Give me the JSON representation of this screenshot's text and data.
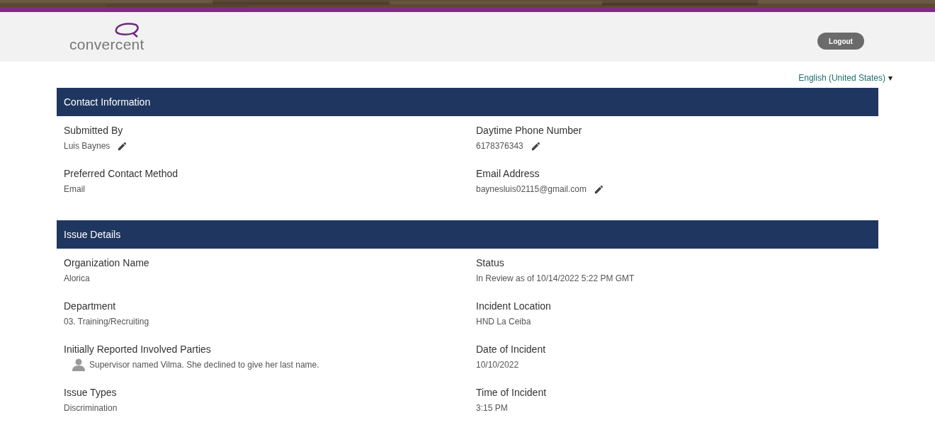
{
  "header": {
    "logo_text": "convercent",
    "logout_button": "Logout"
  },
  "language": {
    "label": "English (United States)",
    "caret": "▾"
  },
  "sections": [
    {
      "title": "Contact Information",
      "columns": [
        [
          {
            "label": "Submitted By",
            "value": "Luis Baynes",
            "kind": "text",
            "editable": true
          },
          {
            "label": "Preferred Contact Method",
            "value": "Email",
            "kind": "text",
            "editable": false
          }
        ],
        [
          {
            "label": "Daytime Phone Number",
            "value": "6178376343",
            "kind": "text",
            "editable": true
          },
          {
            "label": "Email Address",
            "value": "baynesluis02115@gmail.com",
            "kind": "text",
            "editable": true
          }
        ]
      ]
    },
    {
      "title": "Issue Details",
      "columns": [
        [
          {
            "label": "Organization Name",
            "value": "Alorica",
            "kind": "text",
            "editable": false
          },
          {
            "label": "Department",
            "value": "03. Training/Recruiting",
            "kind": "text",
            "editable": false
          },
          {
            "label": "Initially Reported Involved Parties",
            "value": "Supervisor named Vilma. She declined to give her last name.",
            "kind": "person",
            "editable": false
          },
          {
            "label": "Issue Types",
            "value": "Discrimination",
            "kind": "text",
            "editable": false
          }
        ],
        [
          {
            "label": "Status",
            "value": "In Review as of 10/14/2022 5:22 PM GMT",
            "kind": "text",
            "editable": false
          },
          {
            "label": "Incident Location",
            "value": "HND La Ceiba",
            "kind": "text",
            "editable": false
          },
          {
            "label": "Date of Incident",
            "value": "10/10/2022",
            "kind": "text",
            "editable": false
          },
          {
            "label": "Time of Incident",
            "value": "3:15 PM",
            "kind": "text",
            "editable": false
          }
        ]
      ]
    }
  ]
}
